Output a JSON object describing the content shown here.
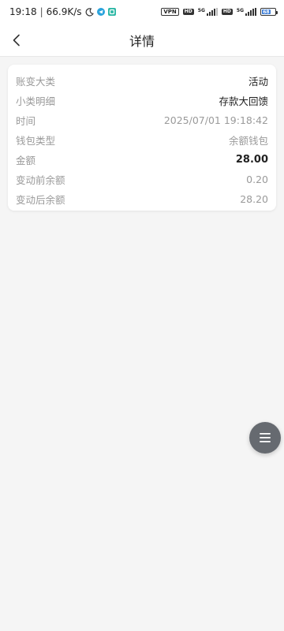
{
  "status_bar": {
    "time": "19:18",
    "speed": "66.9K/s",
    "vpn_label": "VPN",
    "hd_label": "HD",
    "network_label": "5G",
    "battery_level": "68",
    "icons": [
      "moon-icon",
      "telegram-icon",
      "app-icon",
      "vpn-icon",
      "hd-icon",
      "signal-icon",
      "battery-icon"
    ]
  },
  "header": {
    "title": "详情"
  },
  "details": {
    "rows": [
      {
        "label": "账变大类",
        "value": "活动"
      },
      {
        "label": "小类明细",
        "value": "存款大回馈"
      },
      {
        "label": "时间",
        "value": "2025/07/01 19:18:42"
      },
      {
        "label": "钱包类型",
        "value": "余额钱包"
      },
      {
        "label": "金额",
        "value": "28.00"
      },
      {
        "label": "变动前余额",
        "value": "0.20"
      },
      {
        "label": "变动后余额",
        "value": "28.20"
      }
    ]
  },
  "colors": {
    "accent_teal": "#2fb8a6",
    "telegram_blue": "#2aa3dc",
    "float_button": "#666a70"
  }
}
